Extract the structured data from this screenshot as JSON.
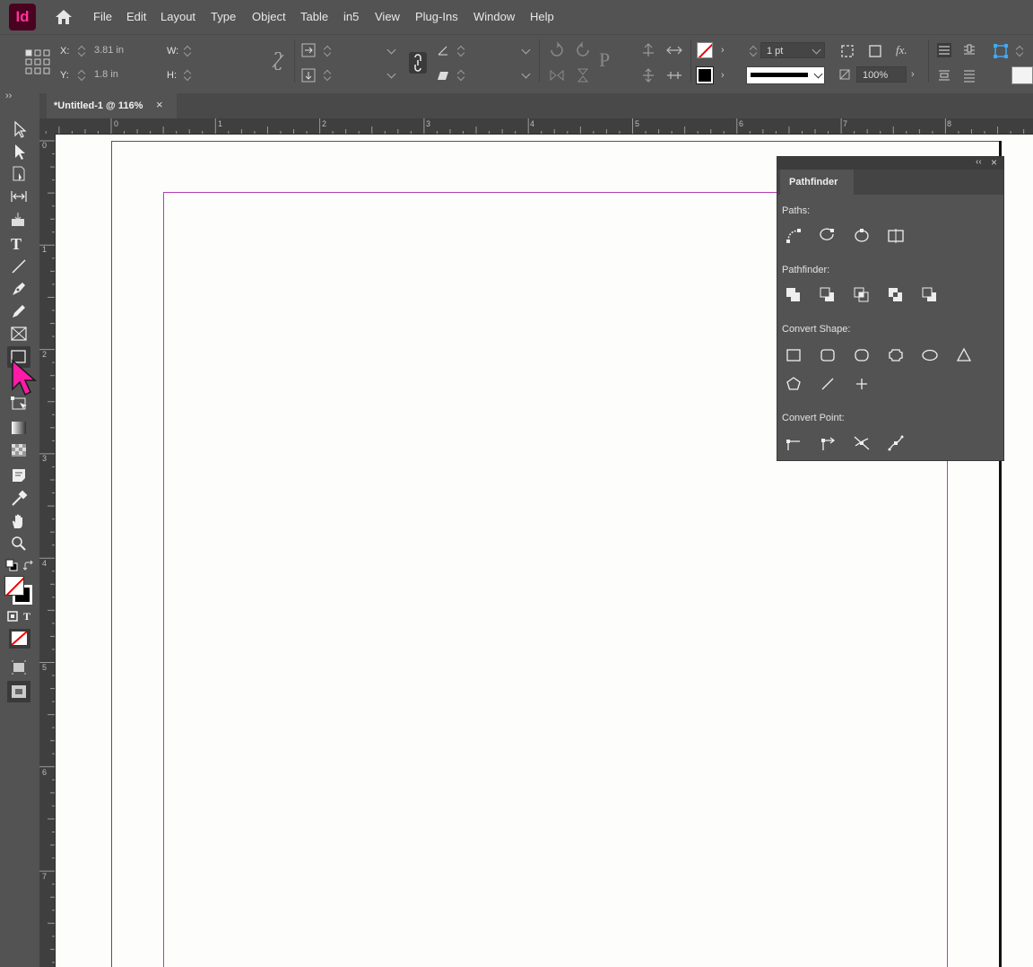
{
  "app": {
    "logo": "Id"
  },
  "menu": [
    "File",
    "Edit",
    "Layout",
    "Type",
    "Object",
    "Table",
    "in5",
    "View",
    "Plug-Ins",
    "Window",
    "Help"
  ],
  "control": {
    "x_label": "X:",
    "x_value": "3.81 in",
    "y_label": "Y:",
    "y_value": "1.8 in",
    "w_label": "W:",
    "h_label": "H:",
    "stroke_weight": "1 pt",
    "opacity": "100%",
    "fx_label": "fx."
  },
  "document": {
    "tab_title": "*Untitled-1 @ 116%",
    "close": "×"
  },
  "ruler": {
    "h_numbers": [
      "0",
      "1",
      "2",
      "3",
      "4",
      "5",
      "6",
      "7",
      "8"
    ],
    "v_numbers": [
      "0",
      "1",
      "2",
      "3",
      "4",
      "5",
      "6",
      "7"
    ]
  },
  "pathfinder": {
    "tab": "Pathfinder",
    "paths_label": "Paths:",
    "pathfinder_label": "Pathfinder:",
    "convert_shape_label": "Convert Shape:",
    "convert_point_label": "Convert Point:"
  },
  "colors": {
    "accent": "#ff1aa8",
    "margin": "#b43db4",
    "page": "#fdfdfb",
    "ui": "#535353"
  }
}
